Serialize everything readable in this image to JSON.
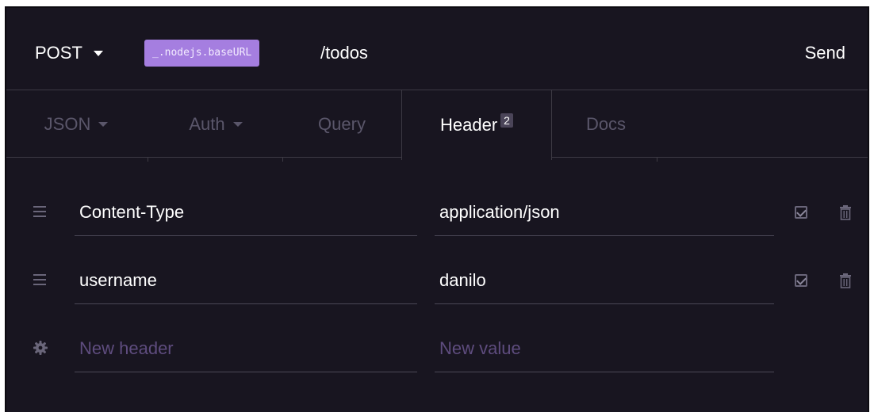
{
  "request": {
    "method": "POST",
    "env_variable": "_.nodejs.baseURL",
    "path": "/todos",
    "send_label": "Send"
  },
  "tabs": [
    {
      "label": "JSON",
      "has_caret": true
    },
    {
      "label": "Auth",
      "has_caret": true
    },
    {
      "label": "Query",
      "has_caret": false
    },
    {
      "label": "Header",
      "badge": "2",
      "active": true
    },
    {
      "label": "Docs",
      "has_caret": false
    }
  ],
  "headers": [
    {
      "name": "Content-Type",
      "value": "application/json",
      "enabled": true
    },
    {
      "name": "username",
      "value": "danilo",
      "enabled": true
    }
  ],
  "new_row": {
    "name_placeholder": "New header",
    "value_placeholder": "New value"
  },
  "colors": {
    "background": "#181520",
    "env_tag": "#a57ee0",
    "placeholder": "#5e4c7e",
    "muted": "#5a566a"
  },
  "icons": {
    "row_handle": "drag-handle-icon",
    "row_toggle": "checkbox-checked-icon",
    "row_delete": "trash-icon",
    "new_row": "gear-icon"
  }
}
